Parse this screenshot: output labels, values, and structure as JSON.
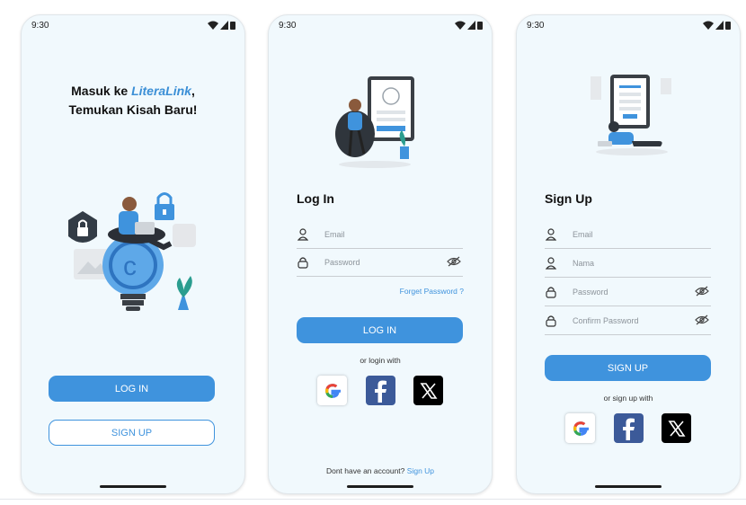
{
  "status": {
    "time": "9:30"
  },
  "welcome": {
    "title_prefix": "Masuk ke ",
    "brand": "LiteraLink",
    "title_suffix": ",",
    "title_line2": "Temukan Kisah Baru!",
    "login_button": "LOG IN",
    "signup_button": "SIGN UP"
  },
  "login": {
    "title": "Log In",
    "email_placeholder": "Email",
    "password_placeholder": "Password",
    "forget_password": "Forget Password ?",
    "login_button": "LOG IN",
    "or_text": "or login with",
    "footer_text": "Dont have an account?",
    "footer_link": "Sign Up"
  },
  "signup": {
    "title": "Sign Up",
    "email_placeholder": "Email",
    "name_placeholder": "Nama",
    "password_placeholder": "Password",
    "confirm_placeholder": "Confirm Password",
    "signup_button": "SIGN UP",
    "or_text": "or sign up with"
  },
  "social_icons": [
    "google-icon",
    "facebook-icon",
    "x-icon"
  ],
  "colors": {
    "accent": "#3f93dd",
    "screen_bg": "#f1f9fd",
    "facebook": "#3c5a99",
    "x": "#000000"
  }
}
